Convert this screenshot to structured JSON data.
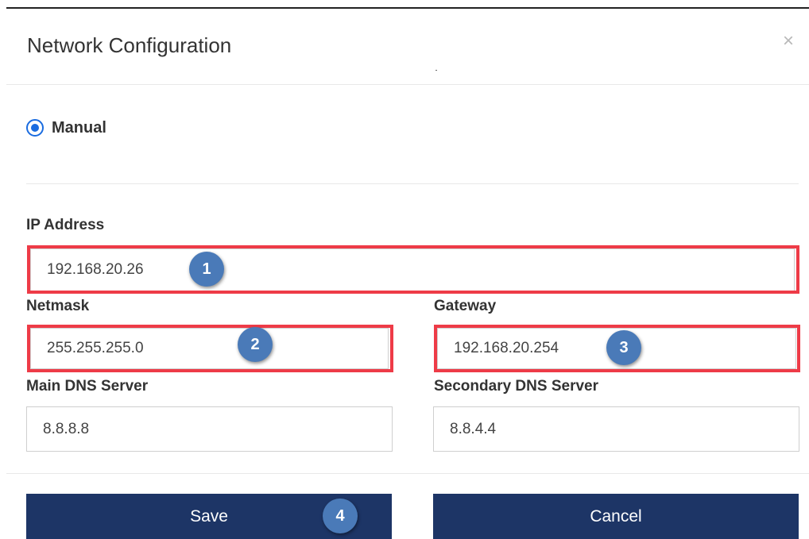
{
  "dialog": {
    "title": "Network Configuration",
    "close_icon": "×"
  },
  "mode": {
    "label": "Manual",
    "selected": true
  },
  "fields": {
    "ip_address": {
      "label": "IP Address",
      "value": "192.168.20.26"
    },
    "netmask": {
      "label": "Netmask",
      "value": "255.255.255.0"
    },
    "gateway": {
      "label": "Gateway",
      "value": "192.168.20.254"
    },
    "main_dns": {
      "label": "Main DNS Server",
      "value": "8.8.8.8"
    },
    "secondary_dns": {
      "label": "Secondary DNS Server",
      "value": "8.8.4.4"
    }
  },
  "buttons": {
    "save": "Save",
    "cancel": "Cancel"
  },
  "annotations": [
    "1",
    "2",
    "3",
    "4"
  ],
  "colors": {
    "primary_button": "#1d3566",
    "radio_accent": "#1a6ce0",
    "highlight_box": "#ee3b47",
    "badge": "#4a7ab8"
  }
}
